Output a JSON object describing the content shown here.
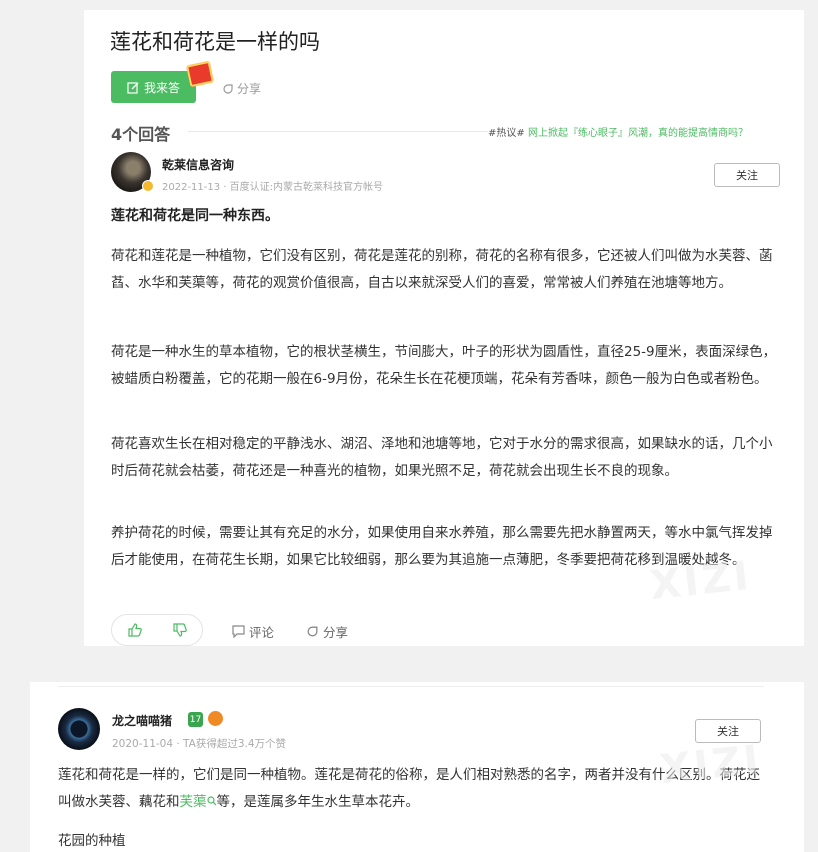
{
  "question": {
    "title": "莲花和荷花是一样的吗",
    "answer_button": "我来答",
    "share": "分享"
  },
  "answers_header": {
    "count": "4个回答",
    "hot_tag": "#热议#",
    "hot_link": "网上掀起『练心眼子』风潮，真的能提高情商吗？"
  },
  "answer1": {
    "author": "乾莱信息咨询",
    "meta": "2022-11-13 · 百度认证:内蒙古乾莱科技官方帐号",
    "follow": "关注",
    "lead": "莲花和荷花是同一种东西。",
    "paragraphs": [
      "荷花和莲花是一种植物，它们没有区别，荷花是莲花的别称，荷花的名称有很多，它还被人们叫做为水芙蓉、菡萏、水华和芙蕖等，荷花的观赏价值很高，自古以来就深受人们的喜爱，常常被人们养殖在池塘等地方。",
      "荷花是一种水生的草本植物，它的根状茎横生，节间膨大，叶子的形状为圆盾性，直径25-9厘米，表面深绿色，被蜡质白粉覆盖，它的花期一般在6-9月份，花朵生长在花梗顶端，花朵有芳香味，颜色一般为白色或者粉色。",
      "荷花喜欢生长在相对稳定的平静浅水、湖沼、泽地和池塘等地，它对于水分的需求很高，如果缺水的话，几个小时后荷花就会枯萎，荷花还是一种喜光的植物，如果光照不足，荷花就会出现生长不良的现象。",
      "养护荷花的时候，需要让其有充足的水分，如果使用自来水养殖，那么需要先把水静置两天，等水中氯气挥发掉后才能使用，在荷花生长期，如果它比较细弱，那么要为其追施一点薄肥，冬季要把荷花移到温暖处越冬。"
    ],
    "comment": "评论",
    "share": "分享"
  },
  "answer2": {
    "author": "龙之喵喵猪",
    "level": "17",
    "meta": "2020-11-04 · TA获得超过3.4万个赞",
    "follow": "关注",
    "text_before": "莲花和荷花是一样的，它们是同一种植物。莲花是荷花的俗称，是人们相对熟悉的名字，两者并没有什么区别。荷花还叫做水芙蓉、藕花和",
    "keyword": "芙蕖",
    "text_after": "等，是莲属多年生水生草本花卉。",
    "next_heading": "花园的种植"
  },
  "watermark": "XIZI",
  "colors": {
    "accent": "#4cbc63",
    "redpacket": "#e83b2b"
  }
}
